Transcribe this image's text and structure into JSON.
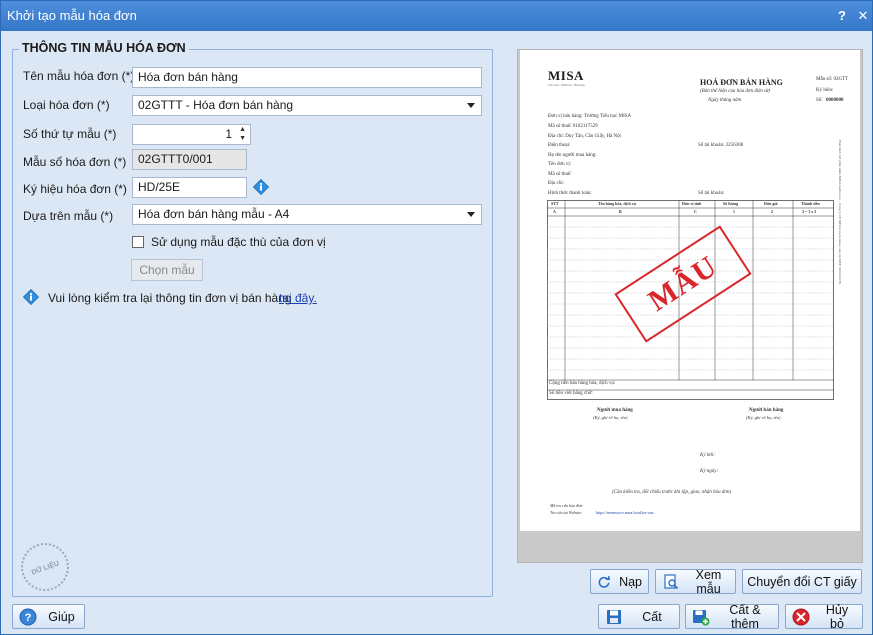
{
  "window": {
    "title": "Khởi tạo mẫu hóa đơn",
    "help_glyph": "?",
    "close_glyph": "✕"
  },
  "group": {
    "title": "THÔNG TIN MẪU HÓA ĐƠN"
  },
  "form": {
    "template_name_label": "Tên mẫu hóa đơn (*)",
    "template_name_value": "Hóa đơn bán hàng",
    "invoice_type_label": "Loại hóa đơn (*)",
    "invoice_type_value": "02GTTT - Hóa đơn bán hàng",
    "ordinal_label": "Số thứ tự mẫu (*)",
    "ordinal_value": "1",
    "template_code_label": "Mẫu số hóa đơn (*)",
    "template_code_value": "02GTTT0/001",
    "symbol_label": "Ký hiệu hóa đơn (*)",
    "symbol_value": "HD/25E",
    "based_on_label": "Dựa trên mẫu (*)",
    "based_on_value": "Hóa đơn bán hàng mẫu - A4",
    "special_template_label": "Sử dụng mẫu đặc thù của đơn vị",
    "special_template_checked": false,
    "choose_template_button": "Chọn mẫu",
    "notice_text": "Vui lòng kiểm tra lại thông tin đơn vị bán hàng",
    "notice_link": "tại đây."
  },
  "preview": {
    "logo": "MISA",
    "logo_tagline": "Trao Giá · Niềm tin · Hài lòng",
    "heading": "HOÁ ĐƠN BÁN HÀNG",
    "subheading": "(Bản thể hiện của hóa đơn điện tử)",
    "date_line": "Ngày      tháng      năm",
    "form_no": "Mẫu số:  02GTT",
    "symbol": "Ký hiệu:",
    "number_label": "Số:",
    "number_value": "0000000",
    "seller": "Đơn vị bán hàng: Trường Tiểu học MISA",
    "tax_code": "Mã số thuế:   0102117529",
    "address": "Địa chỉ:  Duy Tân, Cầu Giấy, Hà Nội",
    "phone": "Điện thoại:",
    "account": "Số tài khoản:     2256308",
    "buyer_name": "Họ tên người mua hàng:",
    "buyer_unit": "Tên đơn vị:",
    "buyer_tax": "Mã số thuế:",
    "buyer_address": "Địa chỉ:",
    "payment": "Hình thức thanh toán:",
    "buyer_account": "Số tài khoản:",
    "table_headers": [
      "STT",
      "Tên hàng hóa, dịch vụ",
      "Đơn vị tính",
      "Số lượng",
      "Đơn giá",
      "Thành tiền"
    ],
    "table_codes": [
      "A",
      "B",
      "C",
      "1",
      "2",
      "3 = 1 x 2"
    ],
    "total_line": "Cộng tiền bán hàng hóa, dịch vụ:",
    "words_line": "Số tiền viết bằng chữ:",
    "buyer_sign": "Người mua hàng",
    "buyer_sign_note": "(Ký, ghi rõ họ, tên)",
    "seller_sign": "Người bán hàng",
    "seller_sign_note": "(Ký, ghi rõ họ, tên)",
    "signed_by": "Ký bởi:",
    "signed_date": "Ký ngày:",
    "footer_note": "(Cần kiểm tra, đối chiếu trước khi lập, giao, nhận hóa đơn)",
    "lookup_code": "Mã tra cứu hóa đơn:",
    "lookup_site": "Tra cứu tại Website:",
    "lookup_url": "https://meinvoice.misa.local/tra-cuu",
    "side_text": "Phát hành bởi phần mềm MISA meInvoice - Công ty CP MISA (www.misa.com.vn)  MST 0101243150",
    "stamp": "MẪU"
  },
  "buttons": {
    "reload": "Nạp",
    "view_template": "Xem mẫu",
    "convert": "Chuyển đổi CT giấy",
    "help": "Giúp",
    "save": "Cất",
    "save_add": "Cất & thêm",
    "cancel": "Hủy bỏ"
  },
  "watermark": "DỮ LIỆU MẪU",
  "colors": {
    "titlebar": "#3a7fd0",
    "background": "#dce7f5",
    "link": "#1a3fb0",
    "stamp": "#d9262c",
    "info": "#2f8fe0"
  }
}
